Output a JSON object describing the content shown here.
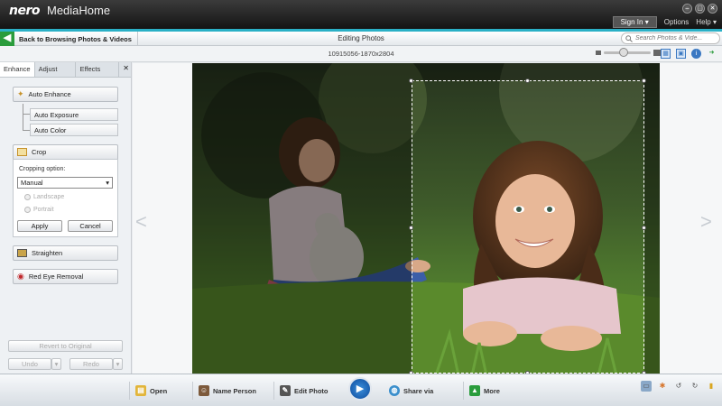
{
  "app": {
    "logo": "nero",
    "name": "MediaHome"
  },
  "window_controls": [
    "–",
    "▢",
    "✕"
  ],
  "top_menu": {
    "sign_in": "Sign In ▾",
    "options": "Options",
    "help": "Help ▾"
  },
  "nav": {
    "back_label": "Back to Browsing Photos & Videos",
    "title": "Editing Photos",
    "search_placeholder": "Search Photos & Vide..."
  },
  "info": {
    "filename": "10915056-1870x2804"
  },
  "zoom": {
    "level": 0.4
  },
  "sidebar": {
    "tabs": [
      "Enhance",
      "Adjust",
      "Effects"
    ],
    "active_tab": "Enhance",
    "close": "✕",
    "auto_enhance": "Auto Enhance",
    "auto_exposure": "Auto Exposure",
    "auto_color": "Auto Color",
    "crop": "Crop",
    "cropping_option_label": "Cropping option:",
    "cropping_option_value": "Manual",
    "landscape": "Landscape",
    "portrait": "Portrait",
    "apply": "Apply",
    "cancel": "Cancel",
    "straighten": "Straighten",
    "red_eye": "Red Eye Removal",
    "revert": "Revert to Original",
    "undo": "Undo",
    "redo": "Redo"
  },
  "bottom": {
    "open": "Open",
    "name_person": "Name Person",
    "edit_photo": "Edit Photo",
    "share_via": "Share via",
    "more": "More"
  },
  "colors": {
    "accent": "#2bb0c6",
    "back_green": "#2a9c3c"
  }
}
